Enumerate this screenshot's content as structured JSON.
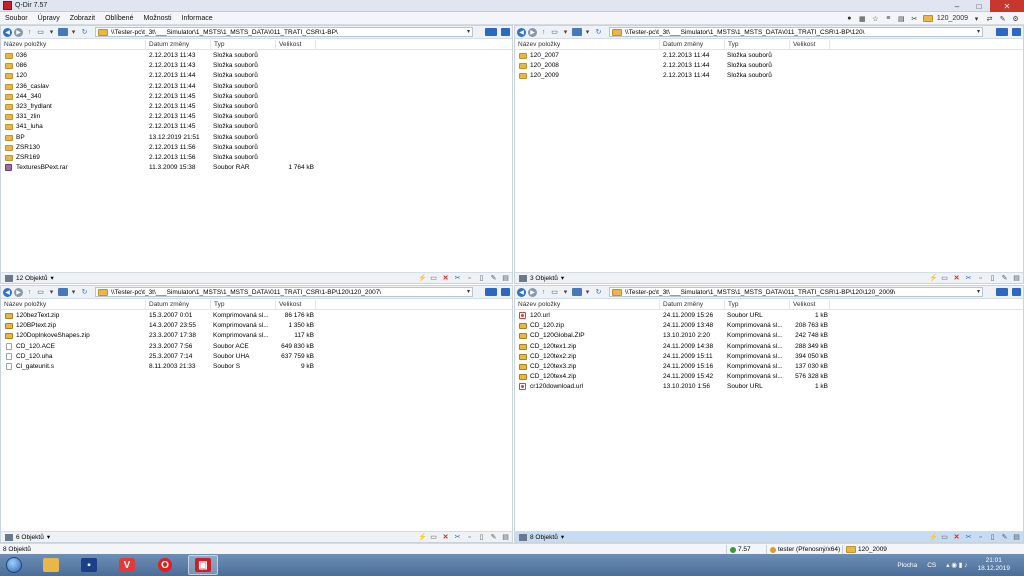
{
  "window": {
    "title": "Q-Dir 7.57",
    "minimize": "–",
    "maximize": "□",
    "close": "✕"
  },
  "menu": {
    "items": [
      "Soubor",
      "Úpravy",
      "Zobrazit",
      "Oblíbené",
      "Možnosti",
      "Informace"
    ],
    "right_folder": "120_2009"
  },
  "columns": {
    "name": "Název položky",
    "date": "Datum změny",
    "type": "Typ",
    "size": "Velikost"
  },
  "panes": [
    {
      "path": "\\\\Tester-pc\\t_3t\\___Simulator\\1_MSTS\\1_MSTS_DATA\\011_TRATI_CSR\\1-BP\\",
      "status": "12 Objektů",
      "rows": [
        {
          "icon": "folder",
          "name": "036",
          "date": "2.12.2013 11:43",
          "type": "Složka souborů",
          "size": ""
        },
        {
          "icon": "folder",
          "name": "086",
          "date": "2.12.2013 11:43",
          "type": "Složka souborů",
          "size": ""
        },
        {
          "icon": "folder",
          "name": "120",
          "date": "2.12.2013 11:44",
          "type": "Složka souborů",
          "size": ""
        },
        {
          "icon": "folder",
          "name": "236_caslav",
          "date": "2.12.2013 11:44",
          "type": "Složka souborů",
          "size": ""
        },
        {
          "icon": "folder",
          "name": "244_340",
          "date": "2.12.2013 11:45",
          "type": "Složka souborů",
          "size": ""
        },
        {
          "icon": "folder",
          "name": "323_frydlant",
          "date": "2.12.2013 11:45",
          "type": "Složka souborů",
          "size": ""
        },
        {
          "icon": "folder",
          "name": "331_zlin",
          "date": "2.12.2013 11:45",
          "type": "Složka souborů",
          "size": ""
        },
        {
          "icon": "folder",
          "name": "341_luha",
          "date": "2.12.2013 11:45",
          "type": "Složka souborů",
          "size": ""
        },
        {
          "icon": "folder",
          "name": "BP",
          "date": "13.12.2019 21:51",
          "type": "Složka souborů",
          "size": ""
        },
        {
          "icon": "folder",
          "name": "ZSR130",
          "date": "2.12.2013 11:56",
          "type": "Složka souborů",
          "size": ""
        },
        {
          "icon": "folder",
          "name": "ZSR169",
          "date": "2.12.2013 11:56",
          "type": "Složka souborů",
          "size": ""
        },
        {
          "icon": "rar",
          "name": "TexturesBPext.rar",
          "date": "11.3.2009 15:38",
          "type": "Soubor RAR",
          "size": "1 764 kB"
        }
      ]
    },
    {
      "path": "\\\\Tester-pc\\t_3t\\___Simulator\\1_MSTS\\1_MSTS_DATA\\011_TRATI_CSR\\1-BP\\120\\",
      "status": "3 Objektů",
      "rows": [
        {
          "icon": "folder",
          "name": "120_2007",
          "date": "2.12.2013 11:44",
          "type": "Složka souborů",
          "size": ""
        },
        {
          "icon": "folder",
          "name": "120_2008",
          "date": "2.12.2013 11:44",
          "type": "Složka souborů",
          "size": ""
        },
        {
          "icon": "folder",
          "name": "120_2009",
          "date": "2.12.2013 11:44",
          "type": "Složka souborů",
          "size": ""
        }
      ]
    },
    {
      "path": "\\\\Tester-pc\\t_3t\\___Simulator\\1_MSTS\\1_MSTS_DATA\\011_TRATI_CSR\\1-BP\\120\\120_2007\\",
      "status": "6 Objektů",
      "rows": [
        {
          "icon": "zip",
          "name": "120bezText.zip",
          "date": "15.3.2007 0:01",
          "type": "Komprimovaná sl...",
          "size": "86 176 kB"
        },
        {
          "icon": "zip",
          "name": "120BPtext.zip",
          "date": "14.3.2007 23:55",
          "type": "Komprimovaná sl...",
          "size": "1 350 kB"
        },
        {
          "icon": "zip",
          "name": "120DoplnkoveShapes.zip",
          "date": "23.3.2007 17:38",
          "type": "Komprimovaná sl...",
          "size": "117 kB"
        },
        {
          "icon": "file",
          "name": "CD_120.ACE",
          "date": "23.3.2007 7:56",
          "type": "Soubor ACE",
          "size": "649 830 kB"
        },
        {
          "icon": "file",
          "name": "CD_120.uha",
          "date": "25.3.2007 7:14",
          "type": "Soubor UHA",
          "size": "637 759 kB"
        },
        {
          "icon": "file",
          "name": "Cl_gateunit.s",
          "date": "8.11.2003 21:33",
          "type": "Soubor S",
          "size": "9 kB"
        }
      ]
    },
    {
      "path": "\\\\Tester-pc\\t_3t\\___Simulator\\1_MSTS\\1_MSTS_DATA\\011_TRATI_CSR\\1-BP\\120\\120_2009\\",
      "status": "8 Objektů",
      "rows": [
        {
          "icon": "url",
          "name": "120.url",
          "date": "24.11.2009 15:26",
          "type": "Soubor URL",
          "size": "1 kB"
        },
        {
          "icon": "zip",
          "name": "CD_120.zip",
          "date": "24.11.2009 13:48",
          "type": "Komprimovaná sl...",
          "size": "208 763 kB"
        },
        {
          "icon": "zip",
          "name": "CD_120Global.ZIP",
          "date": "13.10.2010 2:20",
          "type": "Komprimovaná sl...",
          "size": "242 748 kB"
        },
        {
          "icon": "zip",
          "name": "CD_120tex1.zip",
          "date": "24.11.2009 14:38",
          "type": "Komprimovaná sl...",
          "size": "288 349 kB"
        },
        {
          "icon": "zip",
          "name": "CD_120tex2.zip",
          "date": "24.11.2009 15:11",
          "type": "Komprimovaná sl...",
          "size": "394 050 kB"
        },
        {
          "icon": "zip",
          "name": "CD_120tex3.zip",
          "date": "24.11.2009 15:16",
          "type": "Komprimovaná sl...",
          "size": "137 030 kB"
        },
        {
          "icon": "zip",
          "name": "CD_120tex4.zip",
          "date": "24.11.2009 15:42",
          "type": "Komprimovaná sl...",
          "size": "576 328 kB"
        },
        {
          "icon": "url",
          "name": "cr120download.url",
          "date": "13.10.2010 1:56",
          "type": "Soubor URL",
          "size": "1 kB"
        }
      ]
    }
  ],
  "app_status": {
    "objects": "8 Objektů",
    "version": "7.57",
    "user": "tester (Přenosný/x64)",
    "folder": "120_2009"
  },
  "taskbar": {
    "tray_label": "Plocha",
    "lang": "CS",
    "time": "21:01",
    "date": "18.12.2019"
  },
  "colors": {
    "active_status": "#c5dcf2",
    "folder": "#e8b64a",
    "close": "#c8372d"
  }
}
